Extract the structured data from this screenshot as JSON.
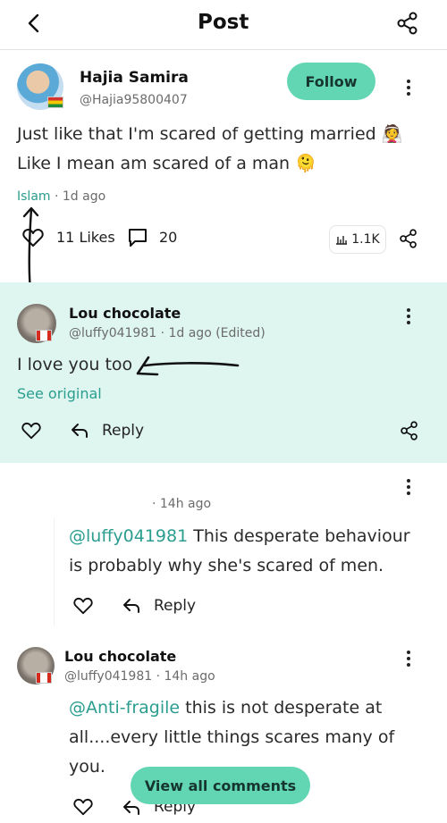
{
  "header": {
    "title": "Post"
  },
  "post": {
    "author": "Hajia Samira",
    "handle": "@Hajia95800407",
    "follow_label": "Follow",
    "text_line1": "Just like that I'm scared of getting married 👰",
    "text_line2": "Like I mean am scared of a man 🫠",
    "tag": "Islam",
    "time": "· 1d ago",
    "likes": "11 Likes",
    "comments": "20",
    "views": "1.1K"
  },
  "comments": [
    {
      "author": "Lou chocolate",
      "handle_meta": "@luffy041981 · 1d ago (Edited)",
      "text": "I love you too",
      "see_original": "See original",
      "reply_label": "Reply"
    },
    {
      "author": "",
      "handle_meta": "· 14h ago",
      "mention": "@luffy041981",
      "text_line1": " This desperate behaviour",
      "text_line2": "is probably why she's scared of men.",
      "reply_label": "Reply"
    },
    {
      "author": "Lou chocolate",
      "handle_meta": "@luffy041981 · 14h ago",
      "mention": "@Anti-fragile",
      "text_line1": " this is not desperate at",
      "text_line2": "all....every little things scares many of",
      "text_line3": "you.",
      "reply_label": "Reply"
    }
  ],
  "footer": {
    "view_all": "View all comments"
  },
  "colors": {
    "accent": "#62d6b2",
    "link": "#2a9d8f",
    "highlight": "#def6ef"
  },
  "icons": [
    "back-chevron-icon",
    "share-icon",
    "more-vertical-icon",
    "heart-icon",
    "comment-icon",
    "views-chart-icon",
    "reply-arrow-icon",
    "flag-icon"
  ]
}
